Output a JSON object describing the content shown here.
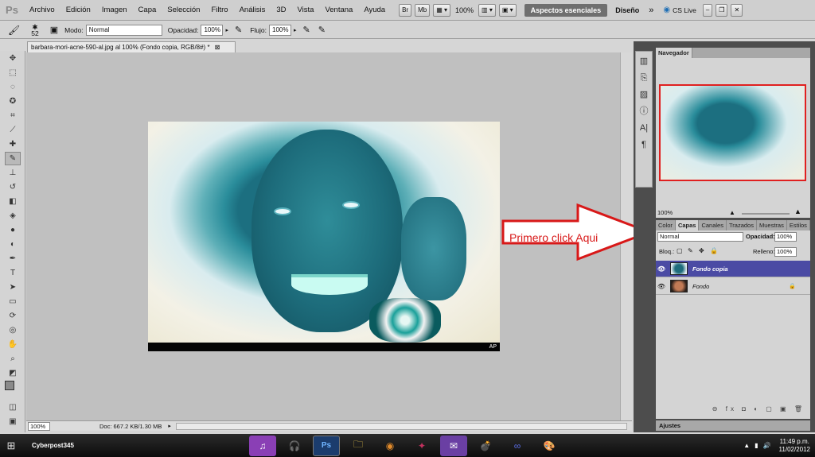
{
  "menubar": {
    "logo": "Ps",
    "items": [
      "Archivo",
      "Edición",
      "Imagen",
      "Capa",
      "Selección",
      "Filtro",
      "Análisis",
      "3D",
      "Vista",
      "Ventana",
      "Ayuda"
    ],
    "zoom": "100%",
    "workspace_active": "Aspectos esenciales",
    "workspace_other": "Diseño",
    "cs_live": "CS Live"
  },
  "options": {
    "brush_size": "52",
    "mode_label": "Modo:",
    "mode_value": "Normal",
    "opacity_label": "Opacidad:",
    "opacity_value": "100%",
    "flow_label": "Flujo:",
    "flow_value": "100%"
  },
  "document": {
    "tab_title": "barbara-mori-acne-590-al.jpg al 100% (Fondo copia, RGB/8#) *",
    "image_credit": "AP",
    "zoom_value": "100%",
    "doc_info": "Doc: 667.2 KB/1.30 MB"
  },
  "navigator": {
    "tab": "Navegador",
    "zoom": "100%"
  },
  "layers": {
    "tabs": [
      "Color",
      "Capas",
      "Canales",
      "Trazados",
      "Muestras",
      "Estilos"
    ],
    "blend_mode": "Normal",
    "opacity_label": "Opacidad:",
    "opacity_value": "100%",
    "lock_label": "Bloq.:",
    "fill_label": "Relleno:",
    "fill_value": "100%",
    "items": [
      {
        "name": "Fondo copia",
        "selected": true
      },
      {
        "name": "Fondo",
        "selected": false
      }
    ],
    "footer_tools": "⊖ fx ◘ ◐ ▢ ▣ 🗑"
  },
  "ajustes": {
    "tab": "Ajustes"
  },
  "annotation": {
    "text": "Primero click Aqui",
    "color": "#d81818"
  },
  "taskbar": {
    "user": "Cyberpost345",
    "time": "11:49 p.m.",
    "date": "11/02/2012"
  },
  "colors": {
    "accent": "#4b4ba4",
    "annotation": "#d81818",
    "canvas_bg": "#c0c0c0"
  }
}
